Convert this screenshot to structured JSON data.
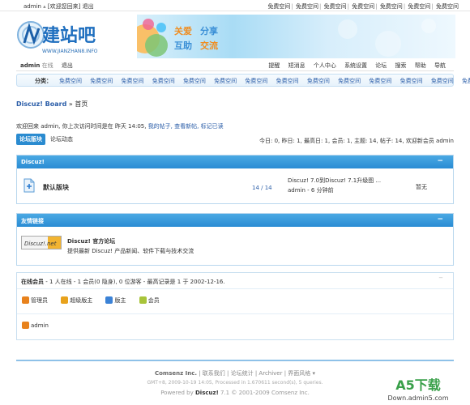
{
  "topbar": {
    "user": "admin",
    "hint": "[欢迎您回来]",
    "logout": "退出",
    "links": [
      "免费空间",
      "免费空间",
      "免费空间",
      "免费空间",
      "免费空间",
      "免费空间",
      "免费空间"
    ]
  },
  "header": {
    "logo_text": "建站吧",
    "logo_sub": "WWW.JIANZHAN8.INFO",
    "banner_words": [
      "关爱",
      "分享",
      "互助",
      "交流"
    ]
  },
  "nav": {
    "user": "admin",
    "status": "在线",
    "logout": "退出",
    "menu": [
      "提醒",
      "短消息",
      "个人中心",
      "系统设置",
      "论坛",
      "搜索",
      "帮助",
      "导航"
    ]
  },
  "catbar": {
    "label": "分类：",
    "links": [
      "免费空间",
      "免费空间",
      "免费空间",
      "免费空间",
      "免费空间",
      "免费空间",
      "免费空间",
      "免费空间",
      "免费空间",
      "免费空间",
      "免费空间",
      "免费空间",
      "免费空间",
      "免费空间"
    ]
  },
  "breadcrumb": {
    "board": "Discuz! Board",
    "sep": " » ",
    "home": "首页"
  },
  "welcome": {
    "text": "欢迎回来 admin, 你上次访问时间是在 昨天 14:05, ",
    "links": "我的帖子, 查看新帖, 标记已读"
  },
  "tabs": {
    "active": "论坛版块",
    "other": "论坛动态"
  },
  "stats": "今日: 0, 昨日: 1, 最高日: 1, 会员: 1, 主题: 14, 帖子: 14, 欢迎新会员 admin",
  "forum_panel": {
    "title": "Discuz!",
    "collapse": "−",
    "forum_name": "默认版块",
    "counts": "14 / 14",
    "last_post_title": "Discuz! 7.0到Discuz! 7.1升级图 ...",
    "last_post_meta": "admin - 6 分钟前",
    "moderator": "暂无"
  },
  "links_panel": {
    "title": "友情链接",
    "collapse": "−",
    "logo_text": "Discuz!.net",
    "name": "Discuz! 官方论坛",
    "desc": "提供最新 Discuz! 产品新闻、软件下载与技术交流"
  },
  "online_panel": {
    "title": "在线会员",
    "summary": " - 1 人在线 - 1 会员(0 隐身), 0 位游客 - 最高记录是 1 于 2002-12-16.",
    "collapse": "−",
    "legend": [
      "管理员",
      "超级版主",
      "版主",
      "会员"
    ],
    "legend_colors": [
      "#e8821c",
      "#e8a21c",
      "#3b82d6",
      "#a8c43a"
    ],
    "users": [
      "admin"
    ]
  },
  "footer": {
    "line1_brand": "Comsenz Inc.",
    "line1_links": " | 联系我们 | 论坛统计 | Archiver | 界面风格 ▾",
    "line2": "GMT+8, 2009-10-19 14:05, Processed in 1.670611 second(s), 5 queries.",
    "line3_prefix": "Powered by ",
    "line3_brand": "Discuz!",
    "line3_suffix": " 7.1 © 2001-2009 Comsenz Inc."
  },
  "watermark": {
    "brand": "A5下载",
    "url": "Down.admin5.com"
  }
}
